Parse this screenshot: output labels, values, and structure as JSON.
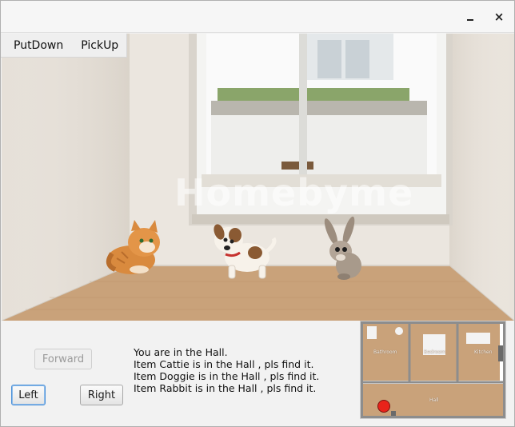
{
  "window": {
    "minimize_label": "–",
    "close_label": "×"
  },
  "menubar": {
    "items": [
      {
        "label": "PutDown"
      },
      {
        "label": "PickUp"
      }
    ]
  },
  "scene": {
    "watermark_text": "Homebyme",
    "room": "Hall",
    "items": [
      {
        "name": "Cattie",
        "icon": "cat-icon"
      },
      {
        "name": "Doggie",
        "icon": "dog-icon"
      },
      {
        "name": "Rabbit",
        "icon": "rabbit-icon"
      }
    ]
  },
  "controls": {
    "forward_label": "Forward",
    "left_label": "Left",
    "right_label": "Right"
  },
  "messages": [
    "You are in the Hall.",
    "Item Cattie is in the Hall , pls find it.",
    "Item Doggie is in the Hall , pls find it.",
    "Item Rabbit is in the Hall , pls find it."
  ],
  "minimap": {
    "rooms": [
      {
        "label": "Bathroom"
      },
      {
        "label": "Bedroom"
      },
      {
        "label": "Kitchen"
      },
      {
        "label": "Hall"
      }
    ],
    "marker_color": "#e8231a"
  },
  "colors": {
    "floor": "#c9a27a",
    "wall": "#ece7e0",
    "focus": "#4a90d9"
  }
}
